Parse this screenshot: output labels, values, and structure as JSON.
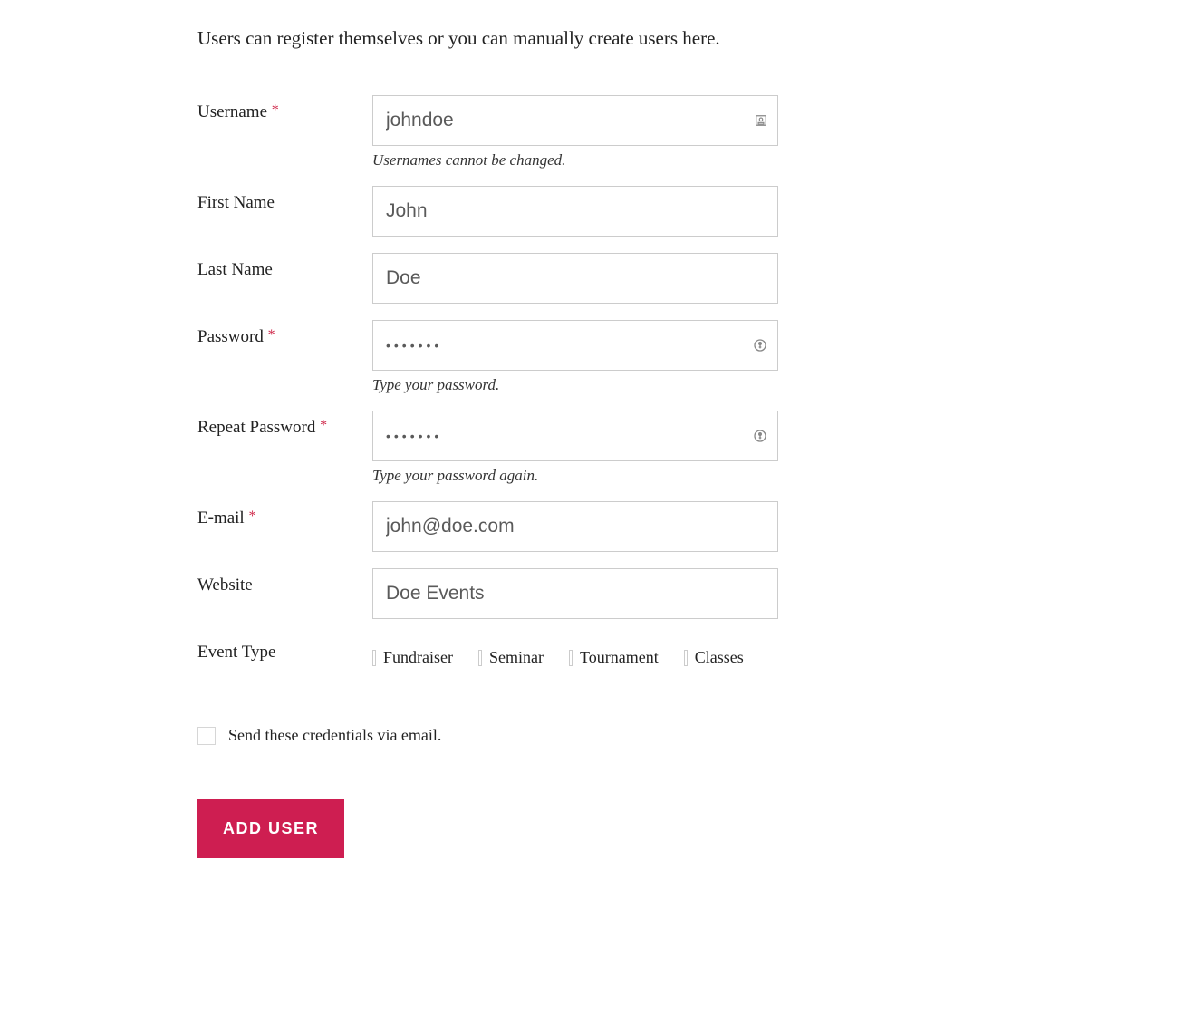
{
  "intro": "Users can register themselves or you can manually create users here.",
  "labels": {
    "username": "Username",
    "first_name": "First Name",
    "last_name": "Last Name",
    "password": "Password",
    "repeat_password": "Repeat Password",
    "email": "E-mail",
    "website": "Website",
    "event_type": "Event Type"
  },
  "values": {
    "username": "johndoe",
    "first_name": "John",
    "last_name": "Doe",
    "password": "•••••••",
    "repeat_password": "•••••••",
    "email": "john@doe.com",
    "website": "Doe Events"
  },
  "hints": {
    "username": "Usernames cannot be changed.",
    "password": "Type your password.",
    "repeat_password": "Type your password again."
  },
  "event_types": [
    "Fundraiser",
    "Seminar",
    "Tournament",
    "Classes"
  ],
  "send_credentials_label": "Send these credentials via email.",
  "send_credentials_checked": false,
  "submit_label": "ADD USER",
  "required_marker": "*"
}
